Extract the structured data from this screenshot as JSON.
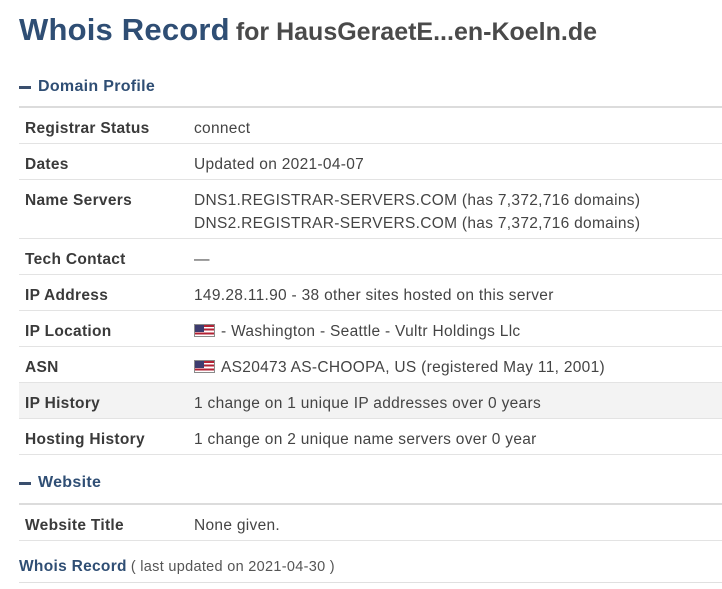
{
  "header": {
    "title": "Whois Record",
    "subtitle": "for HausGeraetE...en-Koeln.de"
  },
  "sections": {
    "domain_profile": "Domain Profile",
    "website": "Website"
  },
  "domain_profile": {
    "registrar_status": {
      "label": "Registrar Status",
      "value": "connect"
    },
    "dates": {
      "label": "Dates",
      "value": "Updated on 2021-04-07"
    },
    "name_servers": {
      "label": "Name Servers",
      "values": [
        "DNS1.REGISTRAR-SERVERS.COM (has 7,372,716 domains)",
        "DNS2.REGISTRAR-SERVERS.COM (has 7,372,716 domains)"
      ]
    },
    "tech_contact": {
      "label": "Tech Contact",
      "value": "—"
    },
    "ip_address": {
      "label": "IP Address",
      "value": "149.28.11.90 - 38 other sites hosted on this server"
    },
    "ip_location": {
      "label": "IP Location",
      "value": "- Washington - Seattle - Vultr Holdings Llc",
      "flag_icon": "us-flag-icon"
    },
    "asn": {
      "label": "ASN",
      "value": "AS20473 AS-CHOOPA, US (registered May 11, 2001)",
      "flag_icon": "us-flag-icon"
    },
    "ip_history": {
      "label": "IP History",
      "value": "1 change on 1 unique IP addresses over 0 years"
    },
    "hosting_history": {
      "label": "Hosting History",
      "value": "1 change on 2 unique name servers over 0 year"
    }
  },
  "website": {
    "website_title": {
      "label": "Website Title",
      "value": "None given."
    }
  },
  "footer": {
    "title": "Whois Record",
    "note": "( last updated on 2021-04-30 )"
  },
  "colors": {
    "accent": "#2f4e74",
    "row_shade": "#f3f3f3",
    "border": "#e3e3e3"
  }
}
